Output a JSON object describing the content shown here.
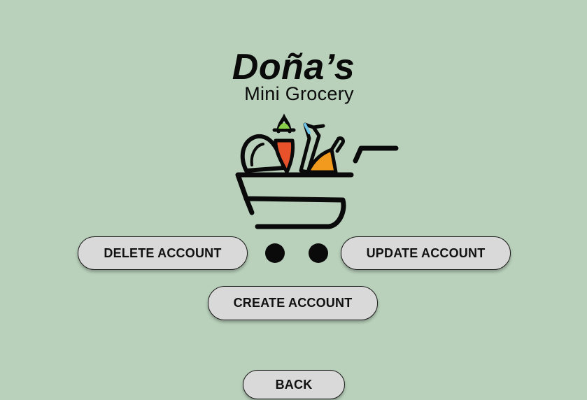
{
  "brand": {
    "title": "Doña’s",
    "subtitle": "Mini Grocery"
  },
  "logo": {
    "icon": "shopping-cart-with-groceries-icon",
    "colors": {
      "outline": "#0a0a0a",
      "leaf": "#8bd04a",
      "carrot": "#e8522b",
      "bottle": "#f29a1e",
      "bottle_cap": "#6fc6e8"
    }
  },
  "actions": {
    "delete_label": "DELETE ACCOUNT",
    "update_label": "UPDATE ACCOUNT",
    "create_label": "CREATE ACCOUNT",
    "back_label": "BACK"
  },
  "colors": {
    "background": "#b9d1bb",
    "button_fill": "#d9d9d9",
    "button_border": "#1a1a1a"
  }
}
